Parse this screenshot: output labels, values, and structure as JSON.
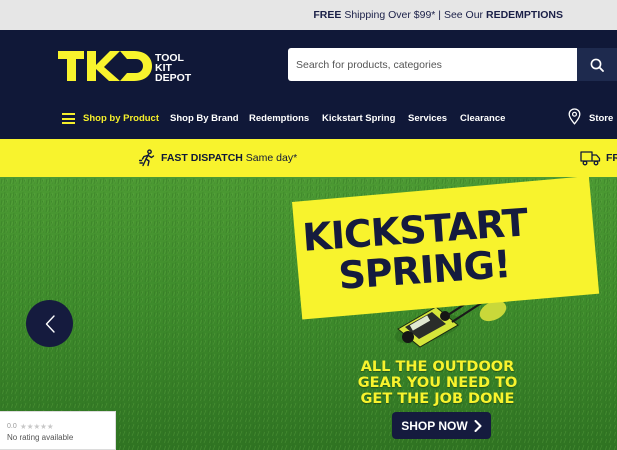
{
  "topbar": {
    "free_label": "FREE",
    "shipping_text": "Shipping Over $99* | See Our",
    "redemptions_label": "REDEMPTIONS"
  },
  "header": {
    "logo": {
      "mark": "TKD",
      "line1": "TOOL",
      "line2": "KIT",
      "line3": "DEPOT"
    },
    "search_placeholder": "Search for products, categories"
  },
  "nav": {
    "items": [
      "Shop by Product",
      "Shop By Brand",
      "Redemptions",
      "Kickstart Spring",
      "Services",
      "Clearance"
    ],
    "store_label": "Store"
  },
  "promo": {
    "dispatch_bold": "FAST DISPATCH",
    "dispatch_text": "Same day*",
    "second_bold": "FR"
  },
  "hero": {
    "title_line1": "KICKSTART",
    "title_line2": "SPRING!",
    "subtitle_line1": "ALL THE OUTDOOR",
    "subtitle_line2": "GEAR YOU NEED TO",
    "subtitle_line3": "GET THE JOB DONE",
    "cta_label": "SHOP NOW"
  },
  "rating_widget": {
    "score": "0.0",
    "stars": "★★★★★",
    "text": "No rating available"
  },
  "colors": {
    "navy": "#101838",
    "accent_yellow": "#f8f32d",
    "grass_green": "#3f8a2c"
  }
}
